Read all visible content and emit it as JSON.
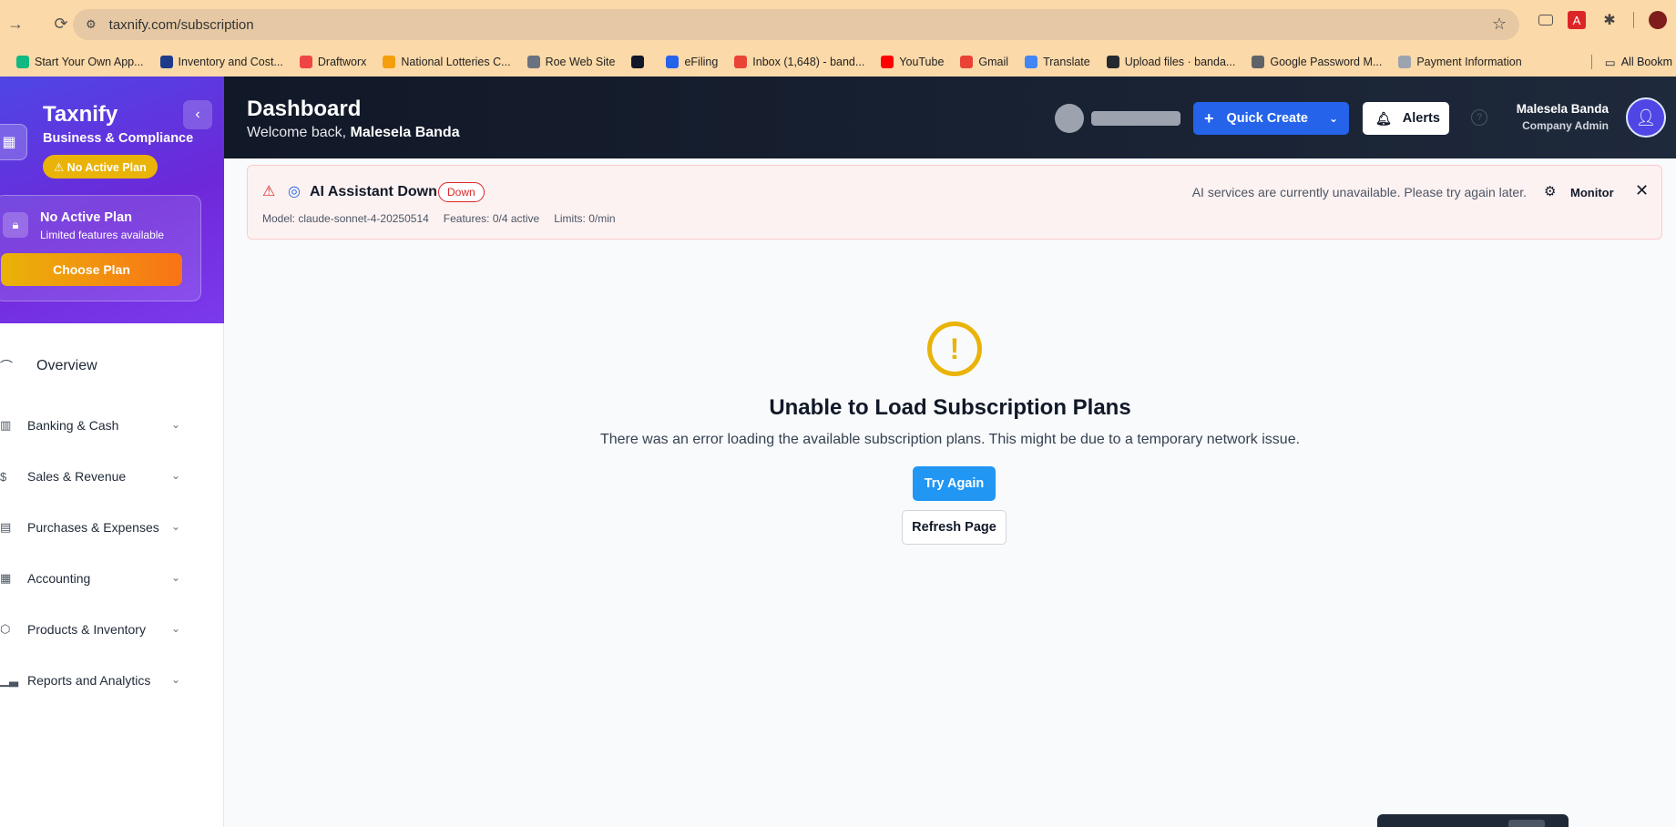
{
  "browser": {
    "url": "taxnify.com/subscription",
    "bookmarks": [
      {
        "label": "Start Your Own App...",
        "color": "#10b981"
      },
      {
        "label": "Inventory and Cost...",
        "color": "#1e3a8a"
      },
      {
        "label": "Draftworx",
        "color": "#ef4444"
      },
      {
        "label": "National Lotteries C...",
        "color": "#f59e0b"
      },
      {
        "label": "Roe Web Site",
        "color": "#6b7280"
      },
      {
        "label": "",
        "color": "#111827"
      },
      {
        "label": "eFiling",
        "color": "#2563eb"
      },
      {
        "label": "Inbox (1,648) - band...",
        "color": "#ea4335"
      },
      {
        "label": "YouTube",
        "color": "#ff0000"
      },
      {
        "label": "Gmail",
        "color": "#ea4335"
      },
      {
        "label": "Translate",
        "color": "#4285f4"
      },
      {
        "label": "Upload files · banda...",
        "color": "#24292f"
      },
      {
        "label": "Google Password M...",
        "color": "#5f6368"
      },
      {
        "label": "Payment Information",
        "color": "#9ca3af"
      }
    ],
    "all_bookmarks": "All Bookm"
  },
  "sidebar": {
    "brand": "Taxnify",
    "brand_sub": "Business & Compliance",
    "plan_pill": "⚠ No Active Plan",
    "plan_card_title": "No Active Plan",
    "plan_card_sub": "Limited features available",
    "choose_plan": "Choose Plan",
    "overview": "Overview",
    "items": [
      {
        "label": "Banking & Cash",
        "icon": "bank-icon"
      },
      {
        "label": "Sales & Revenue",
        "icon": "dollar-icon"
      },
      {
        "label": "Purchases & Expenses",
        "icon": "receipt-icon"
      },
      {
        "label": "Accounting",
        "icon": "calculator-icon"
      },
      {
        "label": "Products & Inventory",
        "icon": "package-icon"
      },
      {
        "label": "Reports and Analytics",
        "icon": "bar-chart-icon"
      }
    ]
  },
  "header": {
    "title": "Dashboard",
    "welcome": "Welcome back,",
    "user_first_last": "Malesela Banda",
    "quick_create": "Quick Create",
    "alerts": "Alerts",
    "user_name": "Malesela Banda",
    "user_role": "Company Admin"
  },
  "ai_banner": {
    "title": "AI Assistant Down",
    "badge": "Down",
    "model": "Model: claude-sonnet-4-20250514",
    "features": "Features: 0/4 active",
    "limits": "Limits: 0/min",
    "message": "AI services are currently unavailable. Please try again later.",
    "monitor": "Monitor"
  },
  "main": {
    "error_title": "Unable to Load Subscription Plans",
    "error_desc": "There was an error loading the available subscription plans. This might be due to a temporary network issue.",
    "try_again": "Try Again",
    "refresh": "Refresh Page"
  },
  "colors": {
    "primary": "#2563eb",
    "sidebar_gradient_start": "#4f46e5",
    "warning": "#eab308",
    "danger": "#dc2626"
  }
}
